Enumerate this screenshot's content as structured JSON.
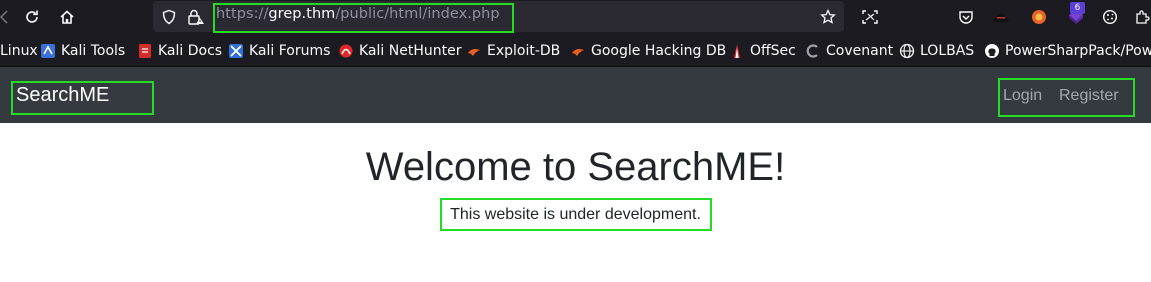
{
  "browser": {
    "url": {
      "scheme": "https://",
      "host": "grep.thm",
      "path": "/public/html/index.php"
    },
    "toolbar_icons": [
      "back-icon",
      "reload-icon",
      "home-icon",
      "shield-icon",
      "lock-icon",
      "star-icon",
      "screenshot-icon",
      "pocket-icon",
      "hat-icon",
      "extension-icon",
      "extension-badge-icon",
      "settings-icon",
      "extension-icon"
    ],
    "extension_badge": "6",
    "bookmarks": [
      {
        "label": "Linux",
        "icon": "kali-icon"
      },
      {
        "label": "Kali Tools",
        "icon": "kali-tools-icon"
      },
      {
        "label": "Kali Docs",
        "icon": "kali-docs-icon"
      },
      {
        "label": "Kali Forums",
        "icon": "kali-forums-icon"
      },
      {
        "label": "Kali NetHunter",
        "icon": "nethunter-icon"
      },
      {
        "label": "Exploit-DB",
        "icon": "exploit-db-icon"
      },
      {
        "label": "Google Hacking DB",
        "icon": "ghdb-icon"
      },
      {
        "label": "OffSec",
        "icon": "offsec-icon"
      },
      {
        "label": "Covenant",
        "icon": "covenant-icon"
      },
      {
        "label": "LOLBAS",
        "icon": "globe-icon"
      },
      {
        "label": "PowerSharpPack/Pow...",
        "icon": "github-icon"
      }
    ]
  },
  "site": {
    "brand": "SearchME",
    "nav": {
      "login": "Login",
      "register": "Register"
    },
    "heading": "Welcome to SearchME!",
    "lead": "This website is under development."
  },
  "colors": {
    "browser_bg": "#1c1b22",
    "urlbar_bg": "#2b2a33",
    "navbar_bg": "#343a40",
    "highlight": "#22dd22",
    "text_dark": "#212529"
  }
}
